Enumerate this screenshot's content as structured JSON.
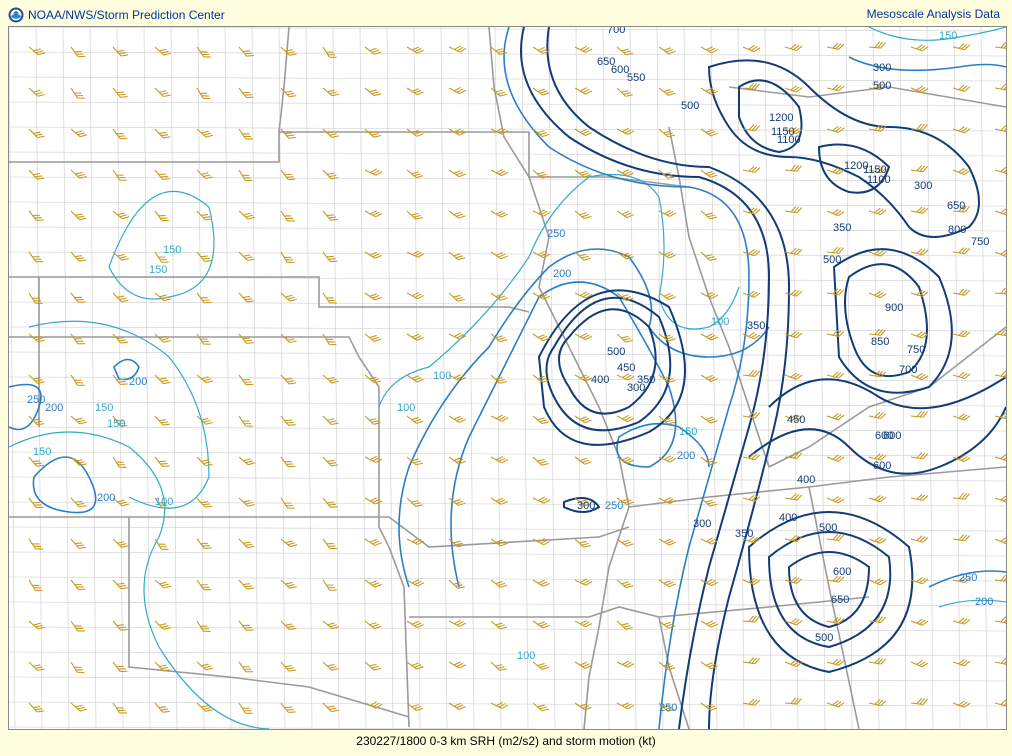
{
  "header": {
    "left_title": "NOAA/NWS/Storm Prediction Center",
    "right_title": "Mesoscale Analysis Data"
  },
  "footer": {
    "caption": "230227/1800 0-3 km SRH (m2/s2) and storm motion (kt)"
  },
  "colors": {
    "background": "#ffffe0",
    "map_bg": "#ffffff",
    "county_lines": "#cccccc",
    "state_lines": "#999999",
    "contour_light": "#33aacc",
    "contour_mid": "#2a7ec8",
    "contour_dark": "#123c78",
    "wind_barbs": "#c89a1e"
  },
  "contour_labels": [
    {
      "text": "700"
    },
    {
      "text": "650"
    },
    {
      "text": "600"
    },
    {
      "text": "550"
    },
    {
      "text": "500"
    },
    {
      "text": "150"
    },
    {
      "text": "300"
    },
    {
      "text": "500"
    },
    {
      "text": "1200"
    },
    {
      "text": "1150"
    },
    {
      "text": "1100"
    },
    {
      "text": "1200"
    },
    {
      "text": "1150"
    },
    {
      "text": "1100"
    },
    {
      "text": "300"
    },
    {
      "text": "650"
    },
    {
      "text": "800"
    },
    {
      "text": "750"
    },
    {
      "text": "350"
    },
    {
      "text": "500"
    },
    {
      "text": "900"
    },
    {
      "text": "850"
    },
    {
      "text": "750"
    },
    {
      "text": "700"
    },
    {
      "text": "600"
    },
    {
      "text": "150"
    },
    {
      "text": "200"
    },
    {
      "text": "250"
    },
    {
      "text": "150"
    },
    {
      "text": "200"
    },
    {
      "text": "150"
    },
    {
      "text": "150"
    },
    {
      "text": "200"
    },
    {
      "text": "100"
    },
    {
      "text": "100"
    },
    {
      "text": "100"
    },
    {
      "text": "150"
    },
    {
      "text": "200"
    },
    {
      "text": "100"
    },
    {
      "text": "350"
    },
    {
      "text": "500"
    },
    {
      "text": "450"
    },
    {
      "text": "400"
    },
    {
      "text": "350"
    },
    {
      "text": "300"
    },
    {
      "text": "150"
    },
    {
      "text": "200"
    },
    {
      "text": "250"
    },
    {
      "text": "300"
    },
    {
      "text": "250"
    },
    {
      "text": "300"
    },
    {
      "text": "350"
    },
    {
      "text": "400"
    },
    {
      "text": "450"
    },
    {
      "text": "400"
    },
    {
      "text": "500"
    },
    {
      "text": "600"
    },
    {
      "text": "600"
    },
    {
      "text": "600"
    },
    {
      "text": "650"
    },
    {
      "text": "500"
    },
    {
      "text": "250"
    },
    {
      "text": "200"
    },
    {
      "text": "100"
    },
    {
      "text": "250"
    }
  ]
}
